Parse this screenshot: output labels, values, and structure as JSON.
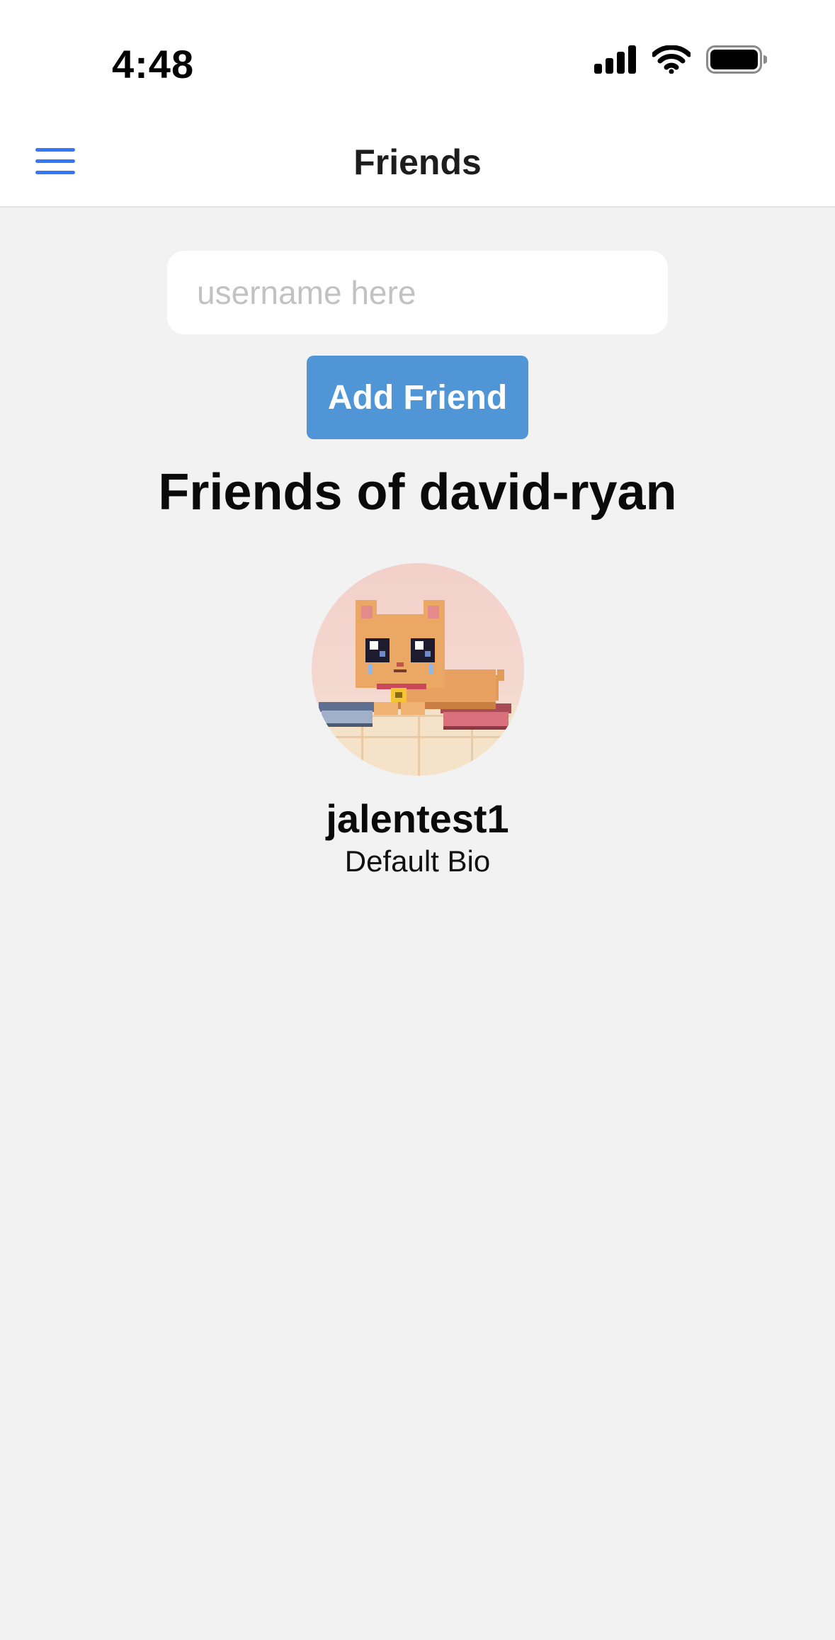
{
  "status_bar": {
    "time": "4:48",
    "icons": [
      "cellular-signal-icon",
      "wifi-icon",
      "battery-icon"
    ]
  },
  "nav": {
    "title": "Friends",
    "menu_icon": "hamburger-menu-icon",
    "accent_color": "#3478f6"
  },
  "add_friend": {
    "input_value": "",
    "placeholder": "username here",
    "button_label": "Add Friend",
    "button_color": "#5096d6"
  },
  "friends_section": {
    "heading": "Friends of david-ryan",
    "friends": [
      {
        "username": "jalentest1",
        "bio": "Default Bio",
        "avatar": "pixel-art-cat-avatar"
      }
    ]
  }
}
